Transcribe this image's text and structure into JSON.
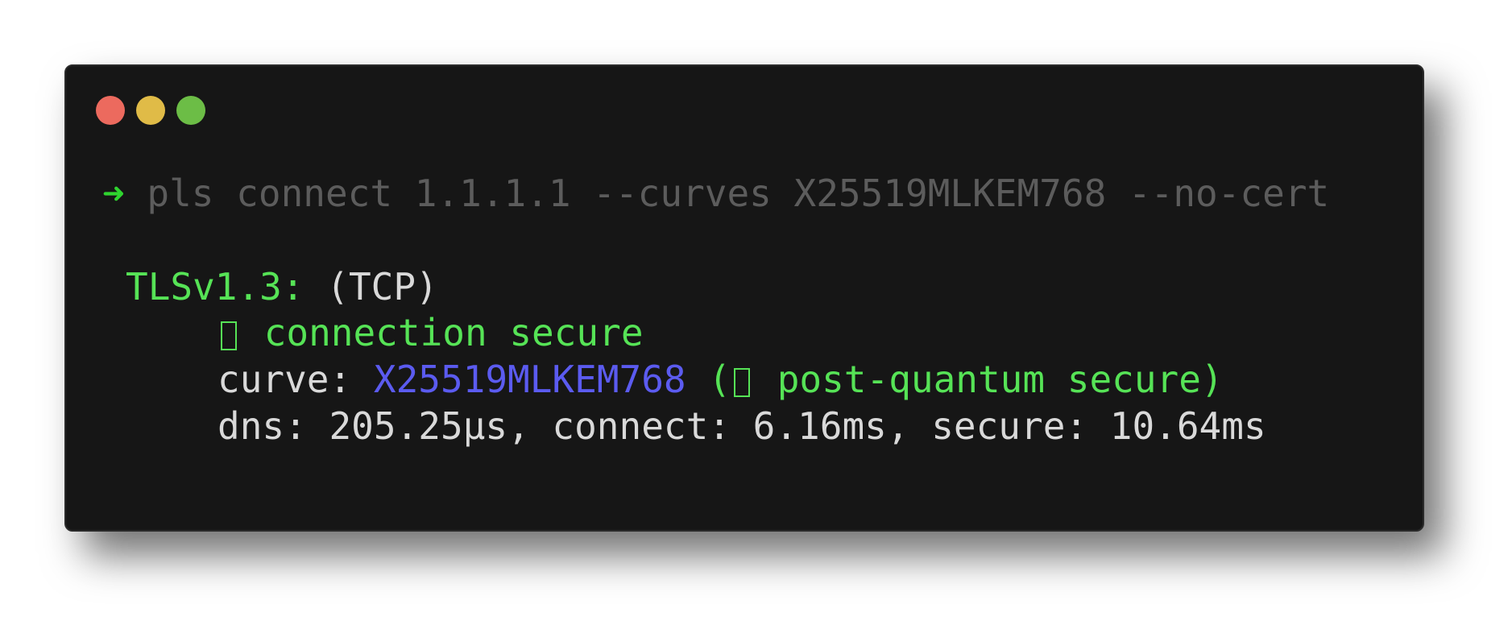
{
  "window": {
    "controls": [
      {
        "name": "close",
        "color": "#ec6a5e"
      },
      {
        "name": "minimize",
        "color": "#e0bb47"
      },
      {
        "name": "maximize",
        "color": "#6cbd46"
      }
    ]
  },
  "prompt": {
    "symbol": "➜",
    "command": "pls connect 1.1.1.1 --curves X25519MLKEM768 --no-cert"
  },
  "output": {
    "protocol_label": "TLSv1.3:",
    "transport": "(TCP)",
    "status_icon": "check-box-icon",
    "status_text": "connection secure",
    "curve_label": "curve:",
    "curve_value": "X25519MLKEM768",
    "pq_open": "(",
    "pq_icon": "check-box-icon",
    "pq_text": "post-quantum secure)",
    "timing": "dns: 205.25µs, connect: 6.16ms, secure: 10.64ms"
  },
  "colors": {
    "background": "#161616",
    "accent_green": "#56e356",
    "curve_blue": "#5b5bf0",
    "command_grey": "#5c5c5c"
  }
}
